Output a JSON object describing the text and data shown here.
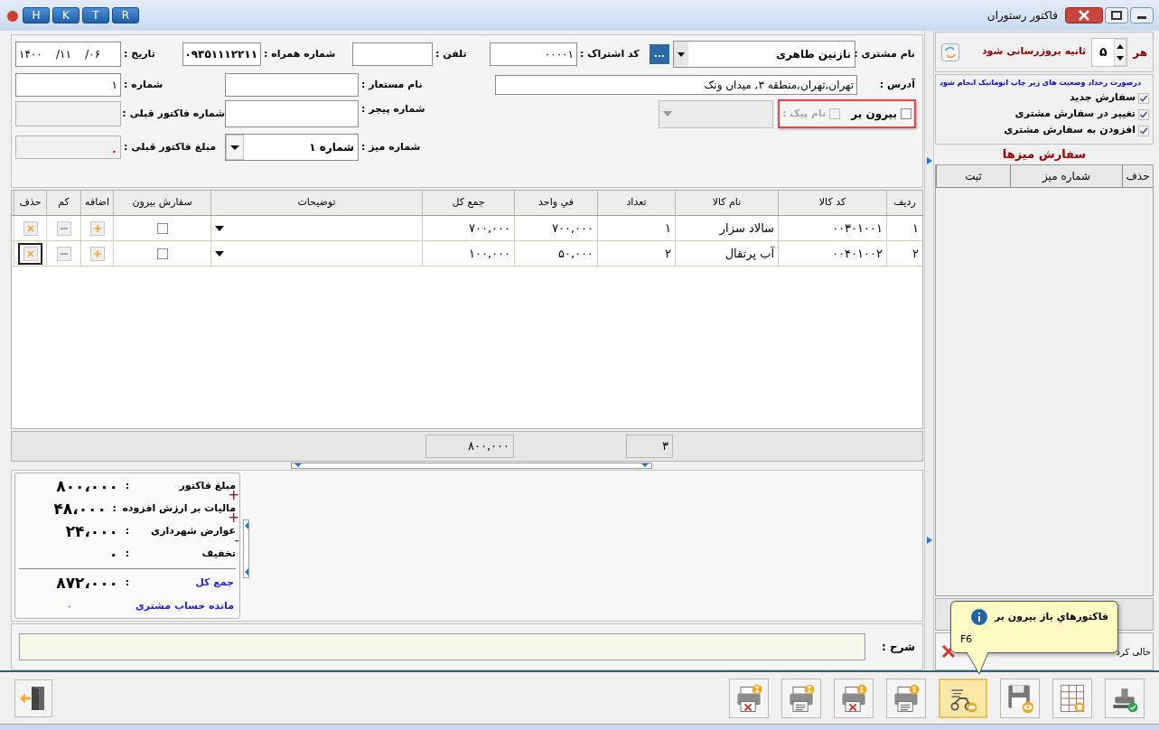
{
  "window": {
    "title": "فاکتور رستوران",
    "quick_buttons": [
      "R",
      "T",
      "K",
      "H"
    ]
  },
  "form": {
    "customer": {
      "label": "نام مشتری :",
      "value": "نازنین طاهری"
    },
    "more_button": "...",
    "subscription_code": {
      "label": "کد اشتراک :",
      "value": "۰۰۰۰۱"
    },
    "phone": {
      "label": "تلفن :"
    },
    "mobile": {
      "label": "شماره همراه :",
      "value": "۰۹۳۵۱۱۱۲۲۱۱"
    },
    "date": {
      "label": "تاریخ :",
      "value": "۱۴۰۰    /۱۱    /۰۶"
    },
    "address": {
      "label": "آدرس :",
      "value": "تهران,تهران,منطقه ۳, میدان ونک"
    },
    "alias": {
      "label": "نام مستعار :"
    },
    "number": {
      "label": "شماره :",
      "value": "۱"
    },
    "takeaway": {
      "label": "بیرون بر",
      "checked": false
    },
    "courier": {
      "label": "نام پیک :",
      "checked": false,
      "disabled": true
    },
    "pager": {
      "label": "شماره پیجر :"
    },
    "previous_invoice_number": {
      "label": "شماره فاکتور قبلی :",
      "disabled": true
    },
    "table_number": {
      "label": "شماره میز :",
      "value": "شماره ۱"
    },
    "previous_invoice_amount": {
      "label": "مبلغ فاکتور قبلی :",
      "value": "۰",
      "disabled": true
    }
  },
  "table": {
    "columns": [
      "ردیف",
      "کد کالا",
      "نام کالا",
      "تعداد",
      "في واحد",
      "جمع کل",
      "توضیحات",
      "سفارش بیرون",
      "اضافه",
      "کم",
      "حذف"
    ],
    "rows": [
      {
        "row": "۱",
        "code": "۰۰۳۰۱۰۰۱",
        "name": "سالاد سزار",
        "quantity": "۱",
        "unit_price": "۷۰۰,۰۰۰",
        "total": "۷۰۰,۰۰۰",
        "takeaway": false,
        "selected": false
      },
      {
        "row": "۲",
        "code": "۰۰۴۰۱۰۰۲",
        "name": "آب پرتقال",
        "quantity": "۲",
        "unit_price": "۵۰,۰۰۰",
        "total": "۱۰۰,۰۰۰",
        "takeaway": false,
        "selected": true
      }
    ]
  },
  "totals_bar": {
    "total": "۸۰۰,۰۰۰",
    "quantity": "۳"
  },
  "summary": [
    {
      "label": "مبلغ فاکتور",
      "separator": ":",
      "value": "۸۰۰،۰۰۰",
      "kind": "amount"
    },
    {
      "label": "مالیات بر ارزش افزوده",
      "separator": ":",
      "value": "۴۸،۰۰۰",
      "sign": "+",
      "kind": "amount"
    },
    {
      "label": "عوارض شهرداری",
      "separator": ":",
      "value": "۲۴،۰۰۰",
      "sign": "+",
      "kind": "amount"
    },
    {
      "label": "تخفیف",
      "separator": ":",
      "value": "۰",
      "sign": "-",
      "kind": "amount"
    },
    {
      "label": "جمع کل",
      "separator": ":",
      "value": "۸۷۲،۰۰۰",
      "kind": "total"
    },
    {
      "label": "مانده حساب مشتری",
      "value": "۰",
      "kind": "balance"
    }
  ],
  "description": {
    "label": "شرح :"
  },
  "refresh": {
    "prefix": "هر",
    "value": "۵",
    "suffix": "ثانیه بروزرسانی شود"
  },
  "auto_print": {
    "heading": "درصورت رخداد وضعیت های زیر چاپ اتوماتیک انجام شود",
    "options": [
      {
        "label": "سفارش جدید",
        "checked": true
      },
      {
        "label": "تغییر در سفارش مشتری",
        "checked": true
      },
      {
        "label": "افزودن به سفارش مشتری",
        "checked": true
      }
    ]
  },
  "table_orders": {
    "title": "سفارش میزها",
    "columns": [
      "حذف",
      "شماره میز",
      "ثبت"
    ]
  },
  "clear_button": "خالی کرد",
  "tooltip": {
    "title": "فاکتورهاي باز بیرون بر",
    "shortcut": "F6"
  },
  "toolbar": [
    {
      "kind": "stamp",
      "selected": false
    },
    {
      "kind": "money-grid",
      "selected": false
    },
    {
      "kind": "save-view",
      "selected": false
    },
    {
      "kind": "scooter-view",
      "selected": true
    },
    {
      "kind": "print-money",
      "selected": false
    },
    {
      "kind": "print-cancel-money",
      "selected": false
    },
    {
      "kind": "print-timer",
      "selected": false
    },
    {
      "kind": "print-cancel-timer",
      "selected": false
    }
  ]
}
